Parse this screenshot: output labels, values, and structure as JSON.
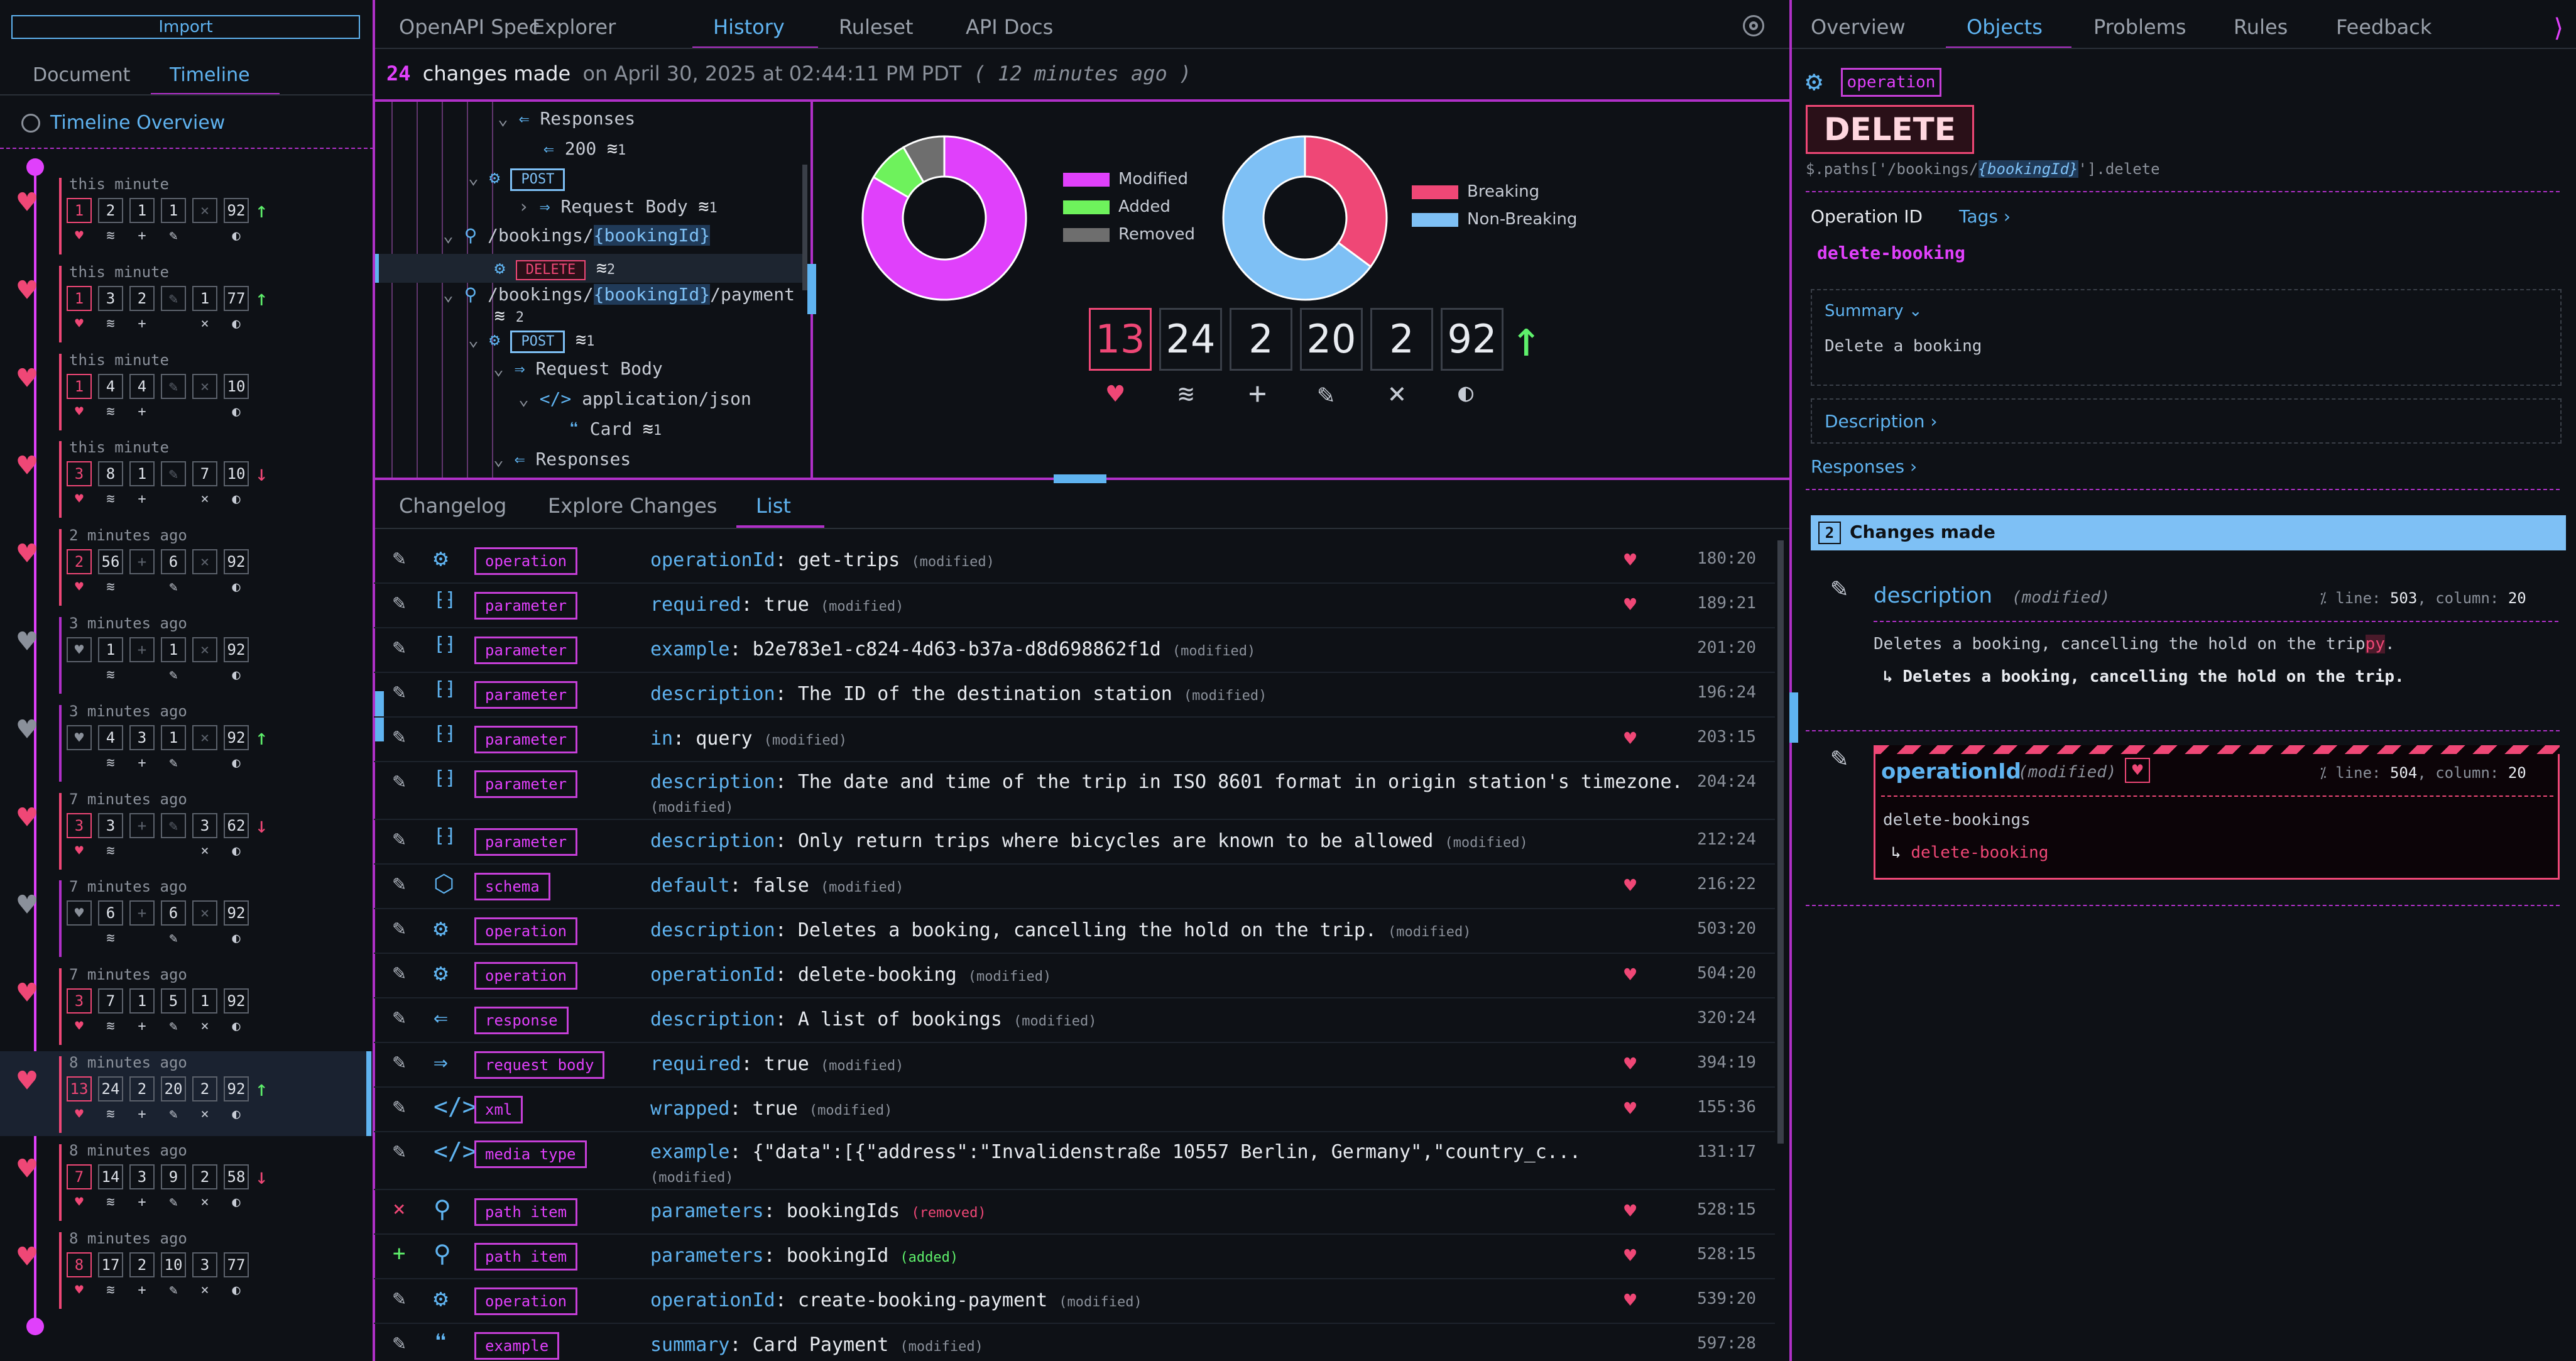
{
  "left": {
    "import_label": "Import",
    "tabs": [
      "Document",
      "Timeline"
    ],
    "overview_title": "Timeline Overview",
    "items": [
      {
        "time": "this minute",
        "counts": [
          "1",
          "2",
          "1",
          "1",
          "",
          "92"
        ],
        "arrow": "up"
      },
      {
        "time": "this minute",
        "counts": [
          "1",
          "3",
          "2",
          "",
          "1",
          "77"
        ],
        "arrow": "up"
      },
      {
        "time": "this minute",
        "counts": [
          "1",
          "4",
          "4",
          "",
          "",
          "10"
        ],
        "arrow": ""
      },
      {
        "time": "this minute",
        "counts": [
          "3",
          "8",
          "1",
          "",
          "7",
          "10"
        ],
        "arrow": "down"
      },
      {
        "time": "2 minutes ago",
        "counts": [
          "2",
          "56",
          "",
          "6",
          "",
          "92"
        ],
        "arrow": ""
      },
      {
        "time": "3 minutes ago",
        "counts": [
          "",
          "1",
          "",
          "1",
          "",
          "92"
        ],
        "arrow": ""
      },
      {
        "time": "3 minutes ago",
        "counts": [
          "",
          "4",
          "3",
          "1",
          "",
          "92"
        ],
        "arrow": "up"
      },
      {
        "time": "7 minutes ago",
        "counts": [
          "3",
          "3",
          "",
          "",
          "3",
          "62"
        ],
        "arrow": "down"
      },
      {
        "time": "7 minutes ago",
        "counts": [
          "",
          "6",
          "",
          "6",
          "",
          "92"
        ],
        "arrow": ""
      },
      {
        "time": "7 minutes ago",
        "counts": [
          "3",
          "7",
          "1",
          "5",
          "1",
          "92"
        ],
        "arrow": ""
      },
      {
        "time": "8 minutes ago",
        "counts": [
          "13",
          "24",
          "2",
          "20",
          "2",
          "92"
        ],
        "arrow": "up"
      },
      {
        "time": "8 minutes ago",
        "counts": [
          "7",
          "14",
          "3",
          "9",
          "2",
          "58"
        ],
        "arrow": "down"
      },
      {
        "time": "8 minutes ago",
        "counts": [
          "8",
          "17",
          "2",
          "10",
          "3",
          "77"
        ],
        "arrow": ""
      }
    ]
  },
  "top_tabs": [
    "OpenAPI Spec",
    "Explorer",
    "History",
    "Ruleset",
    "API Docs"
  ],
  "header": {
    "count": "24",
    "text": "changes made",
    "on": "on April 30, 2025 at 02:44:11 PM PDT",
    "ago": "( 12 minutes ago )"
  },
  "tree": {
    "responses": "Responses",
    "r200": "200",
    "r200_count": "1",
    "post": "POST",
    "request_body": "Request Body",
    "rb_count": "1",
    "path1_a": "/bookings/",
    "path1_b": "{bookingId}",
    "delete": "DELETE",
    "delete_count": "2",
    "path2_c": "/payment",
    "path2_count": "2",
    "post2_count": "1",
    "request_body2": "Request Body",
    "app_json": "application/json",
    "card": "Card",
    "card_count": "1",
    "responses2": "Responses"
  },
  "charts": {
    "legend1": [
      "Modified",
      "Added",
      "Removed"
    ],
    "legend2": [
      "Breaking",
      "Non-Breaking"
    ],
    "colors": {
      "modified": "#e040fb",
      "added": "#6ef25c",
      "removed": "#6e6e6e",
      "breaking": "#ef4776",
      "nonbreaking": "#7ec0f5"
    }
  },
  "chart_data": [
    {
      "type": "pie",
      "labels": [
        "Modified",
        "Added",
        "Removed"
      ],
      "values": [
        20,
        2,
        2
      ]
    },
    {
      "type": "pie",
      "labels": [
        "Breaking",
        "Non-Breaking"
      ],
      "values": [
        13,
        24
      ]
    }
  ],
  "stats": [
    "13",
    "24",
    "2",
    "20",
    "2",
    "92"
  ],
  "bottom_tabs": [
    "Changelog",
    "Explore Changes",
    "List"
  ],
  "list": [
    {
      "act": "pen",
      "icon": "gear",
      "tag": "operation",
      "key": "operationId",
      "val": "get-trips",
      "status": "(modified)",
      "br": true,
      "line": "180:20"
    },
    {
      "act": "pen",
      "icon": "param",
      "tag": "parameter",
      "key": "required",
      "val": "true",
      "status": "(modified)",
      "br": true,
      "line": "189:21"
    },
    {
      "act": "pen",
      "icon": "param",
      "tag": "parameter",
      "key": "example",
      "val": "b2e783e1-c824-4d63-b37a-d8d698862f1d",
      "status": "(modified)",
      "br": false,
      "line": "201:20"
    },
    {
      "act": "pen",
      "icon": "param",
      "tag": "parameter",
      "key": "description",
      "val": "The ID of the destination station",
      "status": "(modified)",
      "br": false,
      "line": "196:24"
    },
    {
      "act": "pen",
      "icon": "param",
      "tag": "parameter",
      "key": "in",
      "val": "query",
      "status": "(modified)",
      "br": true,
      "line": "203:15"
    },
    {
      "act": "pen",
      "icon": "param",
      "tag": "parameter",
      "key": "description",
      "val": "The date and time of the trip in ISO 8601 format in origin station's timezone.",
      "status": "(modified)",
      "br": false,
      "line": "204:24",
      "wrap": true
    },
    {
      "act": "pen",
      "icon": "param",
      "tag": "parameter",
      "key": "description",
      "val": "Only return trips where bicycles are known to be allowed",
      "status": "(modified)",
      "br": false,
      "line": "212:24"
    },
    {
      "act": "pen",
      "icon": "cube",
      "tag": "schema",
      "key": "default",
      "val": "false",
      "status": "(modified)",
      "br": true,
      "line": "216:22"
    },
    {
      "act": "pen",
      "icon": "gear",
      "tag": "operation",
      "key": "description",
      "val": "Deletes a booking, cancelling the hold on the trip.",
      "status": "(modified)",
      "br": false,
      "line": "503:20"
    },
    {
      "act": "pen",
      "icon": "gear",
      "tag": "operation",
      "key": "operationId",
      "val": "delete-booking",
      "status": "(modified)",
      "br": true,
      "line": "504:20"
    },
    {
      "act": "pen",
      "icon": "resp",
      "tag": "response",
      "key": "description",
      "val": "A list of bookings",
      "status": "(modified)",
      "br": false,
      "line": "320:24"
    },
    {
      "act": "pen",
      "icon": "req",
      "tag": "request body",
      "key": "required",
      "val": "true",
      "status": "(modified)",
      "br": true,
      "line": "394:19"
    },
    {
      "act": "pen",
      "icon": "code",
      "tag": "xml",
      "key": "wrapped",
      "val": "true",
      "status": "(modified)",
      "br": true,
      "line": "155:36"
    },
    {
      "act": "pen",
      "icon": "code",
      "tag": "media type",
      "key": "example",
      "val": "{\"data\":[{\"address\":\"Invalidenstraße 10557 Berlin, Germany\",\"country_c...",
      "status": "(modified)",
      "br": false,
      "line": "131:17",
      "wrap": true
    },
    {
      "act": "x",
      "icon": "pin",
      "tag": "path item",
      "key": "parameters",
      "val": "bookingIds",
      "status": "(removed)",
      "br": true,
      "line": "528:15"
    },
    {
      "act": "plus",
      "icon": "pin",
      "tag": "path item",
      "key": "parameters",
      "val": "bookingId",
      "status": "(added)",
      "br": true,
      "line": "528:15"
    },
    {
      "act": "pen",
      "icon": "gear",
      "tag": "operation",
      "key": "operationId",
      "val": "create-booking-payment",
      "status": "(modified)",
      "br": true,
      "line": "539:20"
    },
    {
      "act": "pen",
      "icon": "quote",
      "tag": "example",
      "key": "summary",
      "val": "Card Payment",
      "status": "(modified)",
      "br": false,
      "line": "597:28"
    }
  ],
  "right": {
    "tabs": [
      "Overview",
      "Objects",
      "Problems",
      "Rules",
      "Feedback"
    ],
    "badge": "operation",
    "method": "DELETE",
    "path_a": "$.paths['/bookings/",
    "path_b": "{bookingId}",
    "path_c": "'].delete",
    "op_id_label": "Operation ID",
    "tags_label": "Tags",
    "op_id": "delete-booking",
    "summary_label": "Summary",
    "summary_text": "Delete a booking",
    "description_label": "Description",
    "responses_label": "Responses",
    "changes_count": "2",
    "changes_label": "Changes made",
    "c1": {
      "key": "description",
      "status": "(modified)",
      "line_label": "line:",
      "line": "503",
      "col_label": "column:",
      "col": "20",
      "old_a": "Deletes a booking, cancelling the hold on the trip",
      "old_b": "py",
      "old_c": ".",
      "new": "Deletes a booking, cancelling the hold on the trip."
    },
    "c2": {
      "key": "operationId",
      "status": "(modified)",
      "line_label": "line:",
      "line": "504",
      "col_label": "column:",
      "col": "20",
      "old": "delete-bookings",
      "new": "delete-booking"
    }
  }
}
